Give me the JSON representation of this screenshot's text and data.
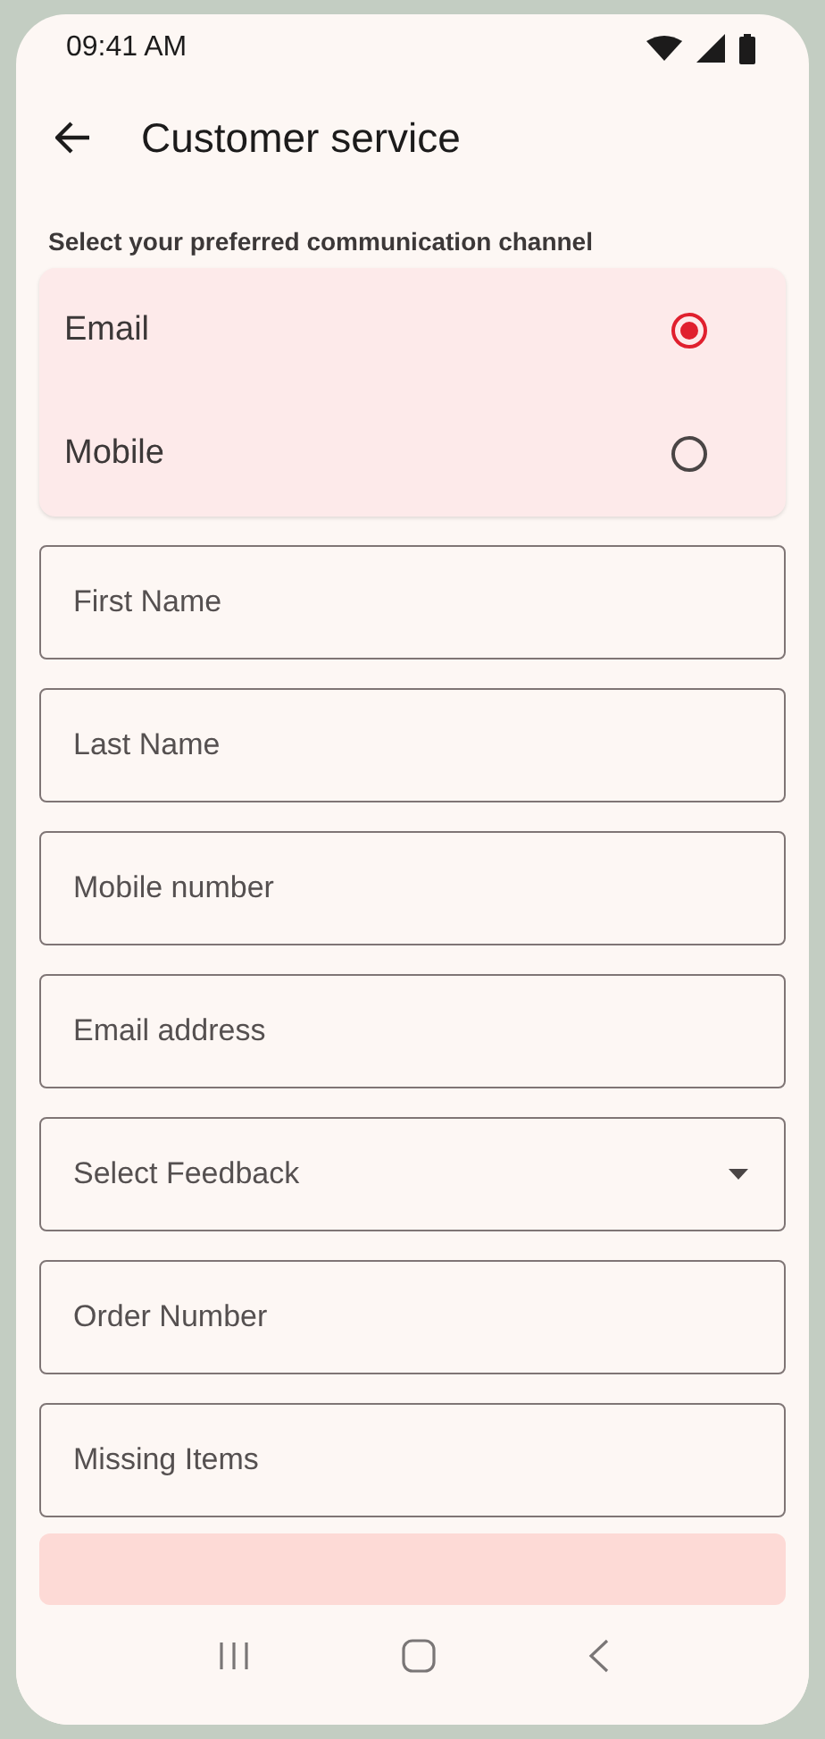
{
  "status_bar": {
    "time": "09:41 AM"
  },
  "header": {
    "title": "Customer service"
  },
  "channel": {
    "label": "Select your preferred communication channel",
    "options": [
      {
        "label": "Email",
        "selected": true
      },
      {
        "label": "Mobile",
        "selected": false
      }
    ]
  },
  "fields": [
    {
      "kind": "text",
      "placeholder": "First Name"
    },
    {
      "kind": "text",
      "placeholder": "Last Name"
    },
    {
      "kind": "text",
      "placeholder": "Mobile number"
    },
    {
      "kind": "text",
      "placeholder": "Email address"
    },
    {
      "kind": "dropdown",
      "placeholder": "Select Feedback"
    },
    {
      "kind": "text",
      "placeholder": "Order Number"
    },
    {
      "kind": "text",
      "placeholder": "Missing Items"
    }
  ]
}
